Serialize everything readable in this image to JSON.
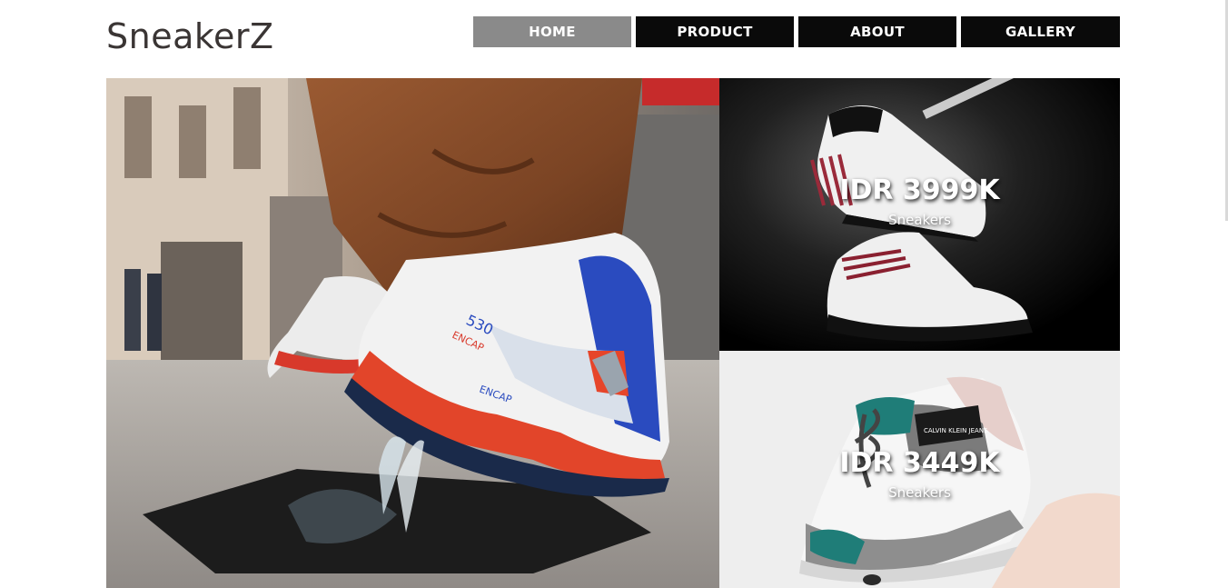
{
  "brand": {
    "name": "SneakerZ"
  },
  "nav": {
    "items": [
      {
        "label": "HOME",
        "active": true
      },
      {
        "label": "PRODUCT",
        "active": false
      },
      {
        "label": "ABOUT",
        "active": false
      },
      {
        "label": "GALLERY",
        "active": false
      }
    ]
  },
  "products": [
    {
      "price": "IDR 3999K",
      "category": "Sneakers"
    },
    {
      "price": "IDR 3449K",
      "category": "Sneakers"
    }
  ],
  "colors": {
    "nav_bg": "#0a0a0a",
    "nav_active_bg": "#8a8a8a",
    "brand_text": "#3a3534"
  }
}
